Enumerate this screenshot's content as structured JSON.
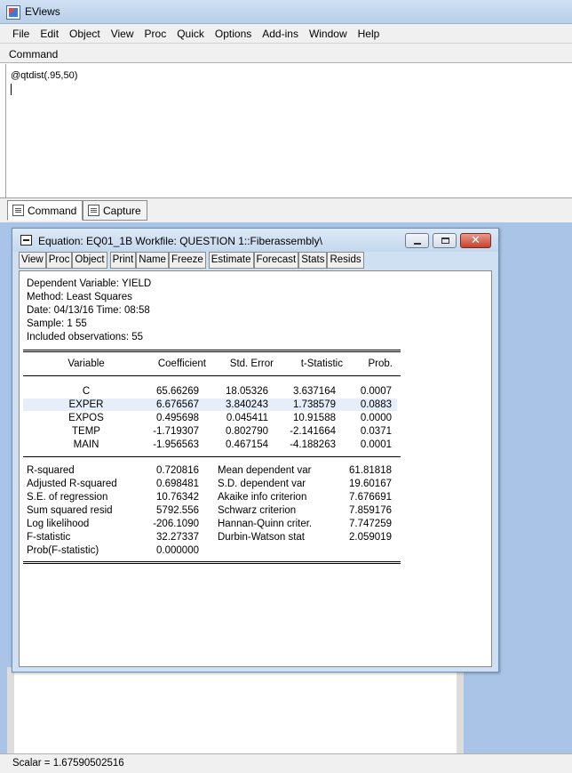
{
  "app": {
    "title": "EViews"
  },
  "menu": [
    "File",
    "Edit",
    "Object",
    "View",
    "Proc",
    "Quick",
    "Options",
    "Add-ins",
    "Window",
    "Help"
  ],
  "command": {
    "label": "Command",
    "text": "@qtdist(.95,50)"
  },
  "tabs": [
    {
      "label": "Command",
      "icon": "command-window-icon"
    },
    {
      "label": "Capture",
      "icon": "capture-window-icon"
    }
  ],
  "equation_window": {
    "title": "Equation: EQ01_1B   Workfile: QUESTION 1::Fiberassembly\\",
    "toolbar": [
      "View",
      "Proc",
      "Object",
      "Print",
      "Name",
      "Freeze",
      "Estimate",
      "Forecast",
      "Stats",
      "Resids"
    ],
    "header": {
      "dependent": "Dependent Variable: YIELD",
      "method": "Method: Least Squares",
      "date": "Date: 04/13/16   Time: 08:58",
      "sample": "Sample: 1 55",
      "observations": "Included observations: 55"
    },
    "columns": [
      "Variable",
      "Coefficient",
      "Std. Error",
      "t-Statistic",
      "Prob."
    ],
    "rows": [
      [
        "C",
        "65.66269",
        "18.05326",
        "3.637164",
        "0.0007"
      ],
      [
        "EXPER",
        "6.676567",
        "3.840243",
        "1.738579",
        "0.0883"
      ],
      [
        "EXPOS",
        "0.495698",
        "0.045411",
        "10.91588",
        "0.0000"
      ],
      [
        "TEMP",
        "-1.719307",
        "0.802790",
        "-2.141664",
        "0.0371"
      ],
      [
        "MAIN",
        "-1.956563",
        "0.467154",
        "-4.188263",
        "0.0001"
      ]
    ],
    "stats": [
      [
        "R-squared",
        "0.720816",
        "Mean dependent var",
        "61.81818"
      ],
      [
        "Adjusted R-squared",
        "0.698481",
        "S.D. dependent var",
        "19.60167"
      ],
      [
        "S.E. of regression",
        "10.76342",
        "Akaike info criterion",
        "7.676691"
      ],
      [
        "Sum squared resid",
        "5792.556",
        "Schwarz criterion",
        "7.859176"
      ],
      [
        "Log likelihood",
        "-206.1090",
        "Hannan-Quinn criter.",
        "7.747259"
      ],
      [
        "F-statistic",
        "32.27337",
        "Durbin-Watson stat",
        "2.059019"
      ],
      [
        "Prob(F-statistic)",
        "0.000000",
        "",
        ""
      ]
    ]
  },
  "status": {
    "text": "Scalar  = 1.67590502516"
  }
}
